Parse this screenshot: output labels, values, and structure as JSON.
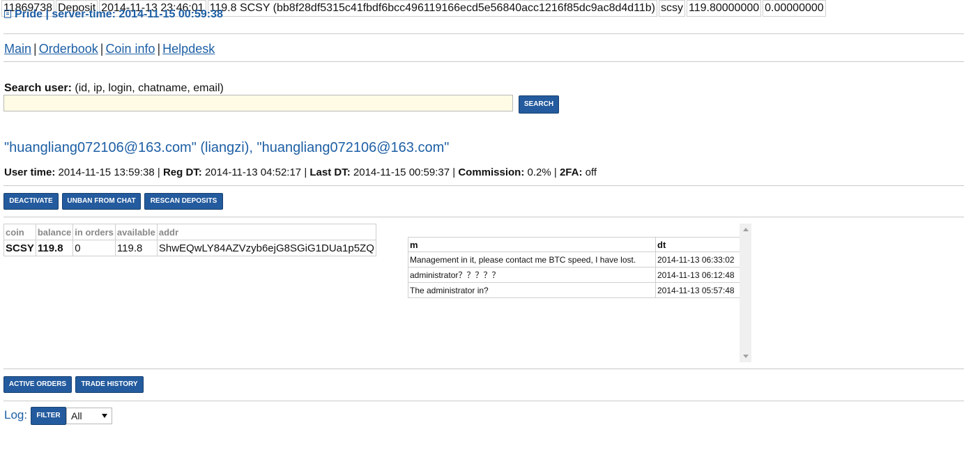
{
  "header": {
    "icon": "document-icon",
    "title": "Pride | server-time: 2014-11-15 00:59:38"
  },
  "nav": {
    "items": [
      "Main",
      "Orderbook",
      "Coin info",
      "Helpdesk"
    ],
    "separator": "|"
  },
  "search": {
    "label_bold": "Search user:",
    "label_hint": "(id, ip, login, chatname, email)",
    "value": "",
    "placeholder": "",
    "button": "SEARCH"
  },
  "user": {
    "heading": "\"huangliang072106@163.com\" (liangzi), \"huangliang072106@163.com\"",
    "info": {
      "user_time_label": "User time:",
      "user_time": "2014-11-15 13:59:38",
      "reg_dt_label": "Reg DT:",
      "reg_dt": "2014-11-13 04:52:17",
      "last_dt_label": "Last DT:",
      "last_dt": "2014-11-15 00:59:37",
      "commission_label": "Commission:",
      "commission": "0.2%",
      "twofa_label": "2FA:",
      "twofa": "off",
      "sep": "|"
    }
  },
  "actions": {
    "deactivate": "DEACTIVATE",
    "unban": "UNBAN FROM CHAT",
    "rescan": "RESCAN DEPOSITS"
  },
  "balances": {
    "headers": [
      "coin",
      "balance",
      "in orders",
      "available",
      "addr"
    ],
    "rows": [
      [
        "SCSY",
        "119.8",
        "0",
        "119.8",
        "ShwEQwLY84AZVzyb6ejG8SGiG1DUa1p5ZQ"
      ]
    ]
  },
  "messages": {
    "headers": [
      "m",
      "dt"
    ],
    "rows": [
      [
        "Management in it, please contact me BTC speed, I have lost.",
        "2014-11-13 06:33:02"
      ],
      [
        "administrator？？？？？",
        "2014-11-13 06:12:48"
      ],
      [
        "The administrator in?",
        "2014-11-13 05:57:48"
      ]
    ]
  },
  "orders_tabs": {
    "active_orders": "ACTIVE ORDERS",
    "trade_history": "TRADE HISTORY"
  },
  "log": {
    "label": "Log:",
    "filter_button": "FILTER",
    "filter_value": "All",
    "rows": [
      [
        "11869738",
        "Deposit",
        "2014-11-13 23:46:01",
        "119.8 SCSY (bb8f28df5315c41fbdf6bcc496119166ecd5e56840acc1216f85dc9ac8d4d11b)",
        "scsy",
        "119.80000000",
        "0.00000000"
      ]
    ]
  },
  "colors": {
    "link": "#1d5fa5",
    "button": "#245b9e",
    "input_bg": "#fffbe5"
  }
}
